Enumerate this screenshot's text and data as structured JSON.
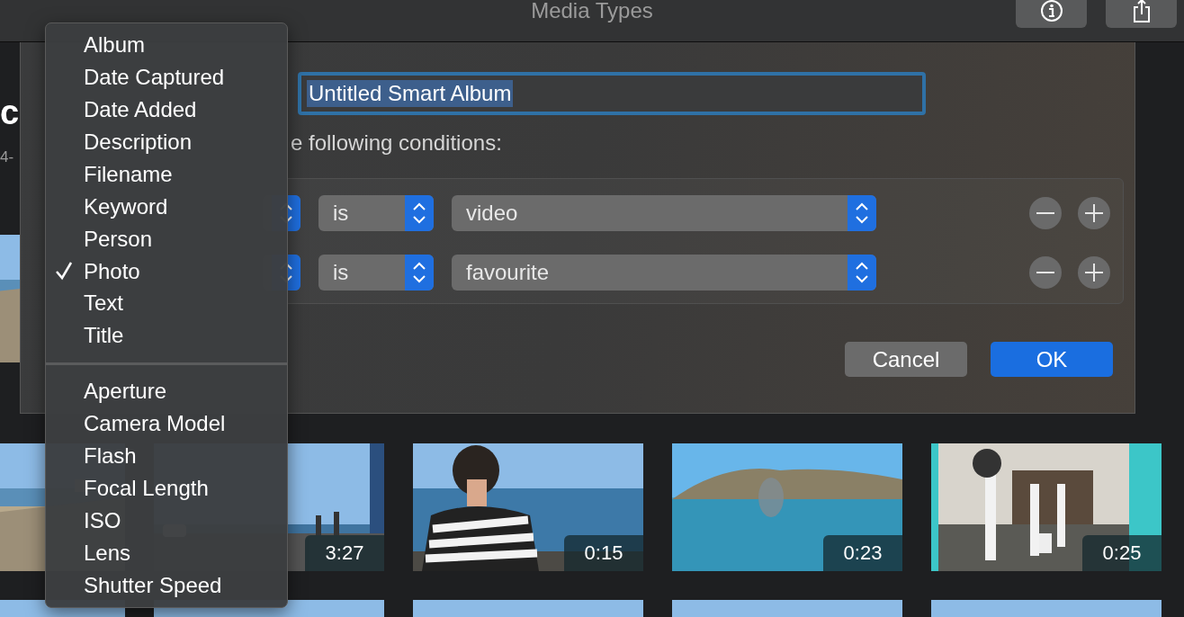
{
  "window": {
    "title": "Media Types"
  },
  "toolbar": {
    "buttons": [
      {
        "kind": "info"
      },
      {
        "kind": "share"
      }
    ]
  },
  "library": {
    "heading": "c",
    "subtitle": "4-",
    "rows": [
      [
        {
          "kind": "picture"
        }
      ],
      [
        {
          "kind": "picture"
        },
        {
          "kind": "picture",
          "duration": "3:27"
        },
        {
          "kind": "picture",
          "duration": "0:15"
        },
        {
          "kind": "picture",
          "duration": "0:23"
        },
        {
          "kind": "picture",
          "duration": "0:25"
        }
      ],
      [
        {
          "kind": "picture"
        },
        {
          "kind": "picture"
        },
        {
          "kind": "picture"
        },
        {
          "kind": "picture"
        },
        {
          "kind": "picture"
        }
      ]
    ]
  },
  "sheet": {
    "name_field": {
      "value": "Untitled Smart Album",
      "selected": true
    },
    "conditions_label": "e following conditions:",
    "conditions": [
      {
        "operator": "is",
        "value": "video"
      },
      {
        "operator": "is",
        "value": "favourite"
      }
    ],
    "buttons": [
      {
        "label": "Cancel",
        "default": false
      },
      {
        "label": "OK",
        "default": true
      }
    ]
  },
  "menu": {
    "groups": [
      [
        {
          "label": "Album",
          "checked": false
        },
        {
          "label": "Date Captured",
          "checked": false
        },
        {
          "label": "Date Added",
          "checked": false
        },
        {
          "label": "Description",
          "checked": false
        },
        {
          "label": "Filename",
          "checked": false
        },
        {
          "label": "Keyword",
          "checked": false
        },
        {
          "label": "Person",
          "checked": false
        },
        {
          "label": "Photo",
          "checked": true
        },
        {
          "label": "Text",
          "checked": false
        },
        {
          "label": "Title",
          "checked": false
        }
      ],
      [
        {
          "label": "Aperture",
          "checked": false
        },
        {
          "label": "Camera Model",
          "checked": false
        },
        {
          "label": "Flash",
          "checked": false
        },
        {
          "label": "Focal Length",
          "checked": false
        },
        {
          "label": "ISO",
          "checked": false
        },
        {
          "label": "Lens",
          "checked": false
        },
        {
          "label": "Shutter Speed",
          "checked": false
        }
      ]
    ]
  }
}
